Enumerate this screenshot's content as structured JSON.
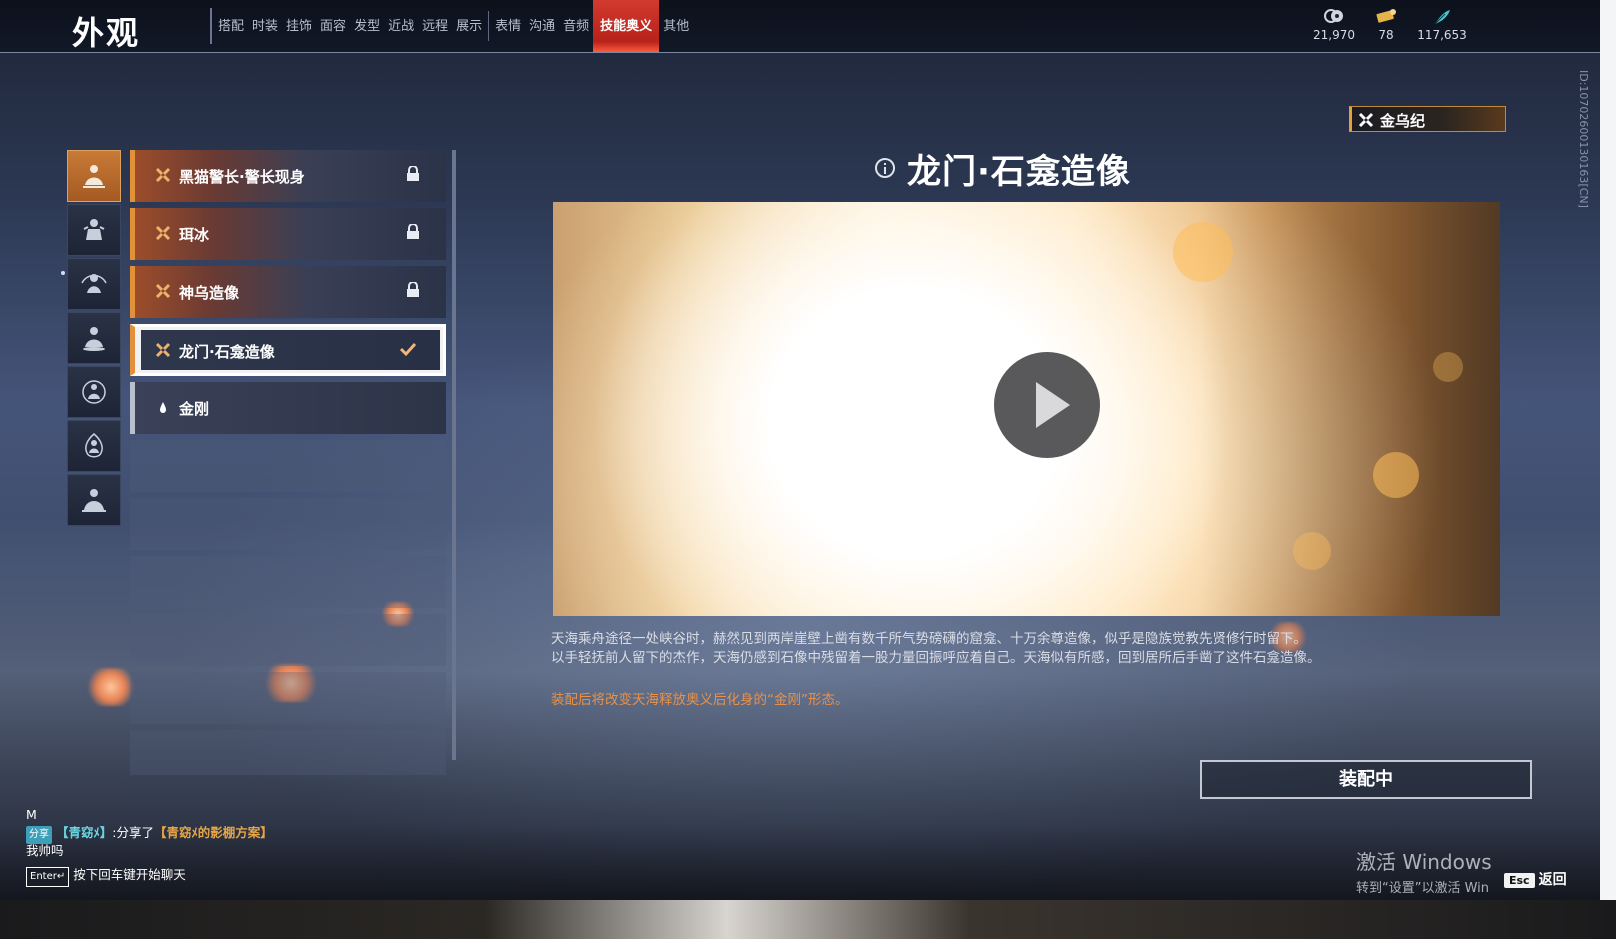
{
  "header": {
    "title": "外观",
    "tabs": [
      {
        "label": "搭配"
      },
      {
        "label": "时装"
      },
      {
        "label": "挂饰"
      },
      {
        "label": "面容"
      },
      {
        "label": "发型"
      },
      {
        "label": "近战"
      },
      {
        "label": "远程"
      },
      {
        "label": "展示"
      },
      {
        "label": "表情"
      },
      {
        "label": "沟通"
      },
      {
        "label": "音频"
      },
      {
        "label": "技能奥义",
        "active": true
      },
      {
        "label": "其他"
      }
    ],
    "currencies": [
      {
        "icon": "coin-stack-icon",
        "value": "21,970"
      },
      {
        "icon": "ticket-icon",
        "value": "78"
      },
      {
        "icon": "feather-icon",
        "value": "117,653"
      }
    ]
  },
  "side_id": "ID:107026001301​63[CN]",
  "categories": [
    {
      "icon": "figure-meditating-icon",
      "active": true
    },
    {
      "icon": "figure-armored-icon"
    },
    {
      "icon": "figure-spinning-icon"
    },
    {
      "icon": "figure-seated-icon"
    },
    {
      "icon": "figure-shield-icon"
    },
    {
      "icon": "figure-flame-icon"
    },
    {
      "icon": "figure-robed-icon"
    }
  ],
  "skill_list": [
    {
      "label": "黑猫警长·警长现身",
      "locked": true
    },
    {
      "label": "珥冰",
      "locked": true
    },
    {
      "label": "神乌造像",
      "locked": true
    },
    {
      "label": "龙门·石龛造像",
      "selected": true
    },
    {
      "label": "金刚",
      "plain": true
    }
  ],
  "preview": {
    "badge": "金乌纪",
    "title": "龙门·石龛造像",
    "description_1": "天海乘舟途径一处峡谷时，赫然见到两岸崖壁上凿有数千所气势磅礴的窟龛、十万余尊造像，似乎是隐族觉教先贤修行时留下。",
    "description_2": "以手轻抚前人留下的杰作，天海仍感到石像中残留着一股力量回振呼应着自己。天海似有所感，回到居所后手凿了这件石龛造像。",
    "note": "装配后将改变天海释放奥义后化身的“金刚”形态。",
    "equip_button": "装配中"
  },
  "chat": {
    "line_m": "M",
    "tag": "分享",
    "sender": "【青窈ﾒ】",
    "shared_prefix": ":分享了",
    "shared_item": "【青窈ﾒ的影棚方案】",
    "message": "我帅吗",
    "enter_key": "Enter↵",
    "hint": "按下回车键开始聊天"
  },
  "watermark": {
    "line1": "激活 Windows",
    "line2": "转到“设置”以激活 Win"
  },
  "esc": {
    "key": "Esc",
    "label": "返回"
  },
  "colors": {
    "accent_red": "#d23a2e",
    "accent_orange": "#e2903a",
    "note_orange": "#e8914a"
  }
}
